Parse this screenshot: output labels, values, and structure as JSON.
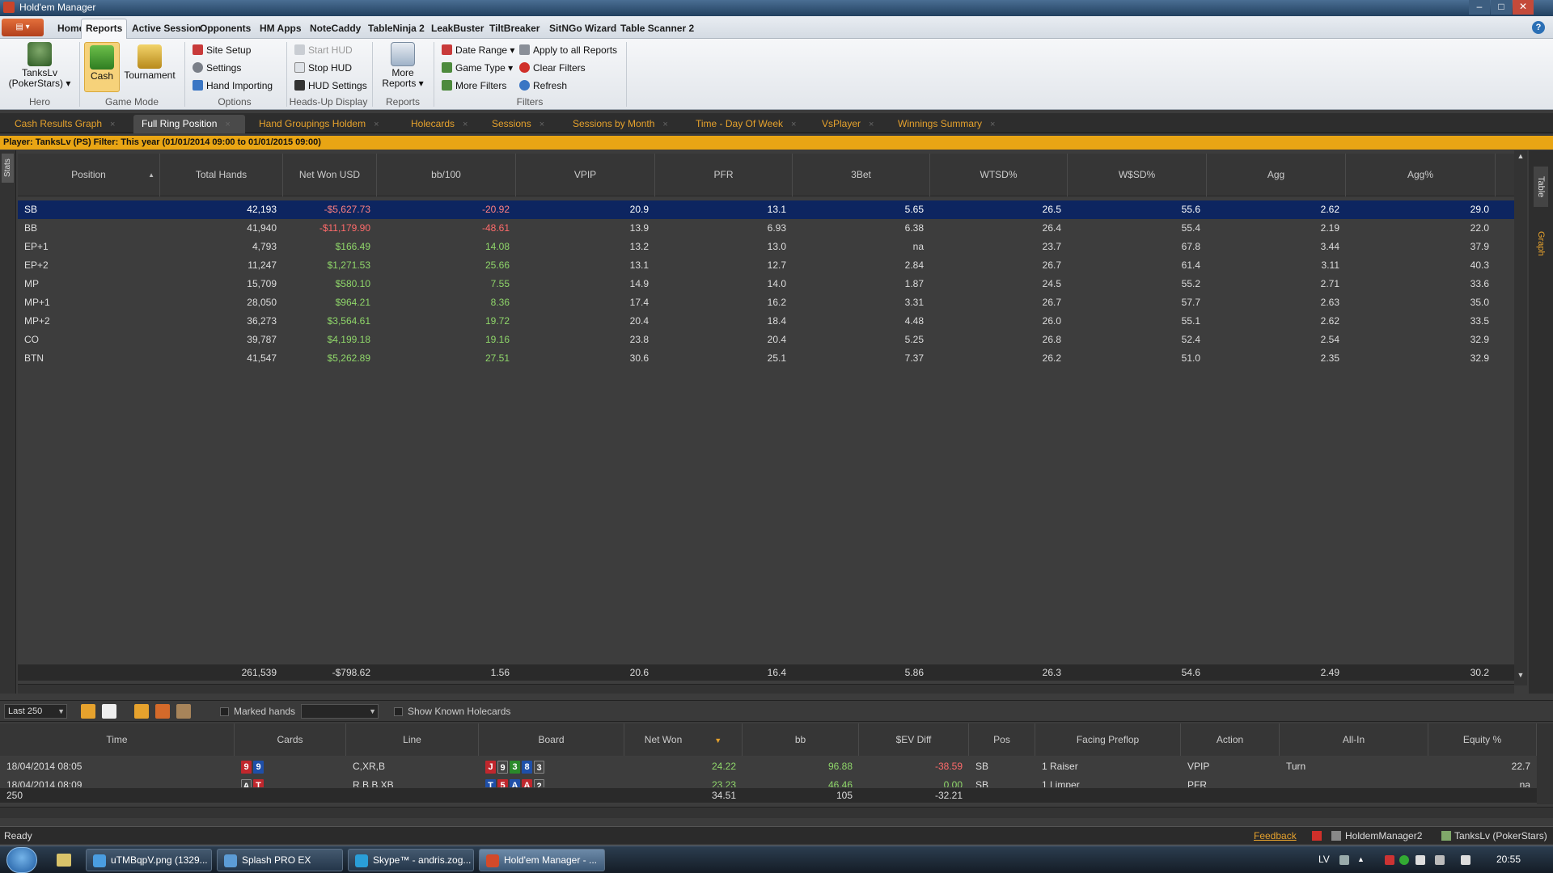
{
  "window": {
    "title": "Hold'em Manager"
  },
  "menu": {
    "app_button": "▤ ▾",
    "tabs": [
      "Home",
      "Reports",
      "Active Session",
      "Opponents",
      "HM Apps",
      "NoteCaddy",
      "TableNinja 2",
      "LeakBuster",
      "TiltBreaker",
      "SitNGo Wizard",
      "Table Scanner 2"
    ],
    "active_tab": "Reports"
  },
  "ribbon": {
    "hero": {
      "name": "TanksLv",
      "site": "(PokerStars) ▾",
      "group": "Hero"
    },
    "game_mode": {
      "cash": "Cash",
      "tournament": "Tournament",
      "group": "Game Mode"
    },
    "options": {
      "site_setup": "Site Setup",
      "settings": "Settings",
      "hand_importing": "Hand Importing",
      "group": "Options"
    },
    "hud": {
      "start": "Start HUD",
      "stop": "Stop HUD",
      "settings": "HUD Settings",
      "group": "Heads-Up Display"
    },
    "reports": {
      "more1": "More",
      "more2": "Reports ▾",
      "group": "Reports"
    },
    "filters": {
      "date_range": "Date Range ▾",
      "game_type": "Game Type ▾",
      "more_filters": "More Filters",
      "apply_all": "Apply to all Reports",
      "clear": "Clear Filters",
      "refresh": "Refresh",
      "group": "Filters"
    }
  },
  "doc_tabs": [
    "Cash Results Graph",
    "Full Ring Position",
    "Hand Groupings Holdem",
    "Holecards",
    "Sessions",
    "Sessions by Month",
    "Time - Day Of Week",
    "VsPlayer",
    "Winnings Summary"
  ],
  "active_doc_tab": "Full Ring Position",
  "filter_bar": "Player: TanksLv (PS)   Filter: This year (01/01/2014 09:00 to 01/01/2015 09:00)",
  "side": {
    "left": "Stats",
    "right_table": "Table",
    "right_graph": "Graph"
  },
  "grid": {
    "columns": [
      "Position",
      "Total Hands",
      "Net Won USD",
      "bb/100",
      "VPIP",
      "PFR",
      "3Bet",
      "WTSD%",
      "W$SD%",
      "Agg",
      "Agg%"
    ],
    "sort_arrow": "▲",
    "rows": [
      [
        "SB",
        "42,193",
        "-$5,627.73",
        "-20.92",
        "20.9",
        "13.1",
        "5.65",
        "26.5",
        "55.6",
        "2.62",
        "29.0"
      ],
      [
        "BB",
        "41,940",
        "-$11,179.90",
        "-48.61",
        "13.9",
        "6.93",
        "6.38",
        "26.4",
        "55.4",
        "2.19",
        "22.0"
      ],
      [
        "EP+1",
        "4,793",
        "$166.49",
        "14.08",
        "13.2",
        "13.0",
        "na",
        "23.7",
        "67.8",
        "3.44",
        "37.9"
      ],
      [
        "EP+2",
        "11,247",
        "$1,271.53",
        "25.66",
        "13.1",
        "12.7",
        "2.84",
        "26.7",
        "61.4",
        "3.11",
        "40.3"
      ],
      [
        "MP",
        "15,709",
        "$580.10",
        "7.55",
        "14.9",
        "14.0",
        "1.87",
        "24.5",
        "55.2",
        "2.71",
        "33.6"
      ],
      [
        "MP+1",
        "28,050",
        "$964.21",
        "8.36",
        "17.4",
        "16.2",
        "3.31",
        "26.7",
        "57.7",
        "2.63",
        "35.0"
      ],
      [
        "MP+2",
        "36,273",
        "$3,564.61",
        "19.72",
        "20.4",
        "18.4",
        "4.48",
        "26.0",
        "55.1",
        "2.62",
        "33.5"
      ],
      [
        "CO",
        "39,787",
        "$4,199.18",
        "19.16",
        "23.8",
        "20.4",
        "5.25",
        "26.8",
        "52.4",
        "2.54",
        "32.9"
      ],
      [
        "BTN",
        "41,547",
        "$5,262.89",
        "27.51",
        "30.6",
        "25.1",
        "7.37",
        "26.2",
        "51.0",
        "2.35",
        "32.9"
      ]
    ],
    "totals": [
      "",
      "261,539",
      "-$798.62",
      "1.56",
      "20.6",
      "16.4",
      "5.86",
      "26.3",
      "54.6",
      "2.49",
      "30.2"
    ]
  },
  "toolbar": {
    "last": "Last 250",
    "marked": "Marked hands",
    "show_known": "Show Known Holecards"
  },
  "hands": {
    "columns": [
      "Time",
      "Cards",
      "Line",
      "Board",
      "Net Won",
      "bb",
      "$EV Diff",
      "Pos",
      "Facing Preflop",
      "Action",
      "All-In",
      "Equity %"
    ],
    "rows": [
      {
        "time": "18/04/2014 08:05",
        "cards": [
          {
            "r": "9",
            "c": "cr"
          },
          {
            "r": "9",
            "c": "cb"
          }
        ],
        "line": "C,XR,B",
        "board": [
          {
            "r": "J",
            "c": "cr"
          },
          {
            "r": "9",
            "c": "ck"
          },
          {
            "r": "3",
            "c": "cg"
          },
          {
            "r": "8",
            "c": "cb"
          },
          {
            "r": "3",
            "c": "ck"
          }
        ],
        "net": "24.22",
        "bb": "96.88",
        "ev": "-38.59",
        "pos": "SB",
        "facing": "1 Raiser",
        "action": "VPIP",
        "allin": "Turn",
        "equity": "22.7"
      },
      {
        "time": "18/04/2014 08:09",
        "cards": [
          {
            "r": "A",
            "c": "ck"
          },
          {
            "r": "T",
            "c": "cr"
          }
        ],
        "line": "R,B,B,XB",
        "board": [
          {
            "r": "T",
            "c": "cb"
          },
          {
            "r": "5",
            "c": "cr"
          },
          {
            "r": "A",
            "c": "cb"
          },
          {
            "r": "A",
            "c": "cr"
          },
          {
            "r": "2",
            "c": "ck"
          }
        ],
        "net": "23.23",
        "bb": "46.46",
        "ev": "0.00",
        "pos": "SB",
        "facing": "1 Limper",
        "action": "PFR",
        "allin": "",
        "equity": "na"
      }
    ],
    "totals": {
      "count": "250",
      "net": "34.51",
      "bb": "105",
      "ev": "-32.21"
    }
  },
  "status": {
    "ready": "Ready",
    "feedback": "Feedback",
    "app": "HoldemManager2",
    "player": "TanksLv (PokerStars)"
  },
  "taskbar": {
    "buttons": [
      "uTMBqpV.png (1329...",
      "Splash PRO EX",
      "Skype™ - andris.zog...",
      "Hold'em Manager - ..."
    ],
    "lang": "LV",
    "time": "20:55"
  },
  "colors": {
    "accent": "#e6a22d",
    "selected_row": "#0d2560",
    "negative": "#ff6b6b",
    "positive": "#8fd66a"
  }
}
